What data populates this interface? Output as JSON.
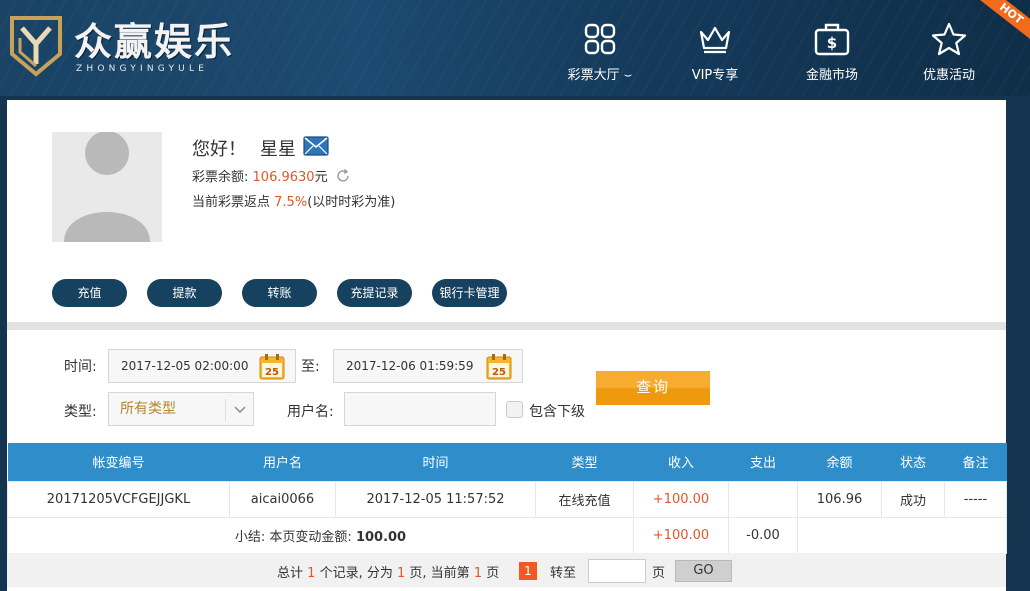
{
  "header": {
    "brand_title": "众赢娱乐",
    "brand_subtitle": "ZHONGYINGYULE",
    "nav": [
      {
        "label": "彩票大厅",
        "icon": "grid-icon"
      },
      {
        "label": "VIP专享",
        "icon": "crown-icon"
      },
      {
        "label": "金融市场",
        "icon": "briefcase-dollar-icon"
      },
      {
        "label": "优惠活动",
        "icon": "star-icon"
      }
    ],
    "hot_badge": "HOT"
  },
  "profile": {
    "greeting": "您好！",
    "username": "星星",
    "balance_label": "彩票余额:",
    "balance_value": "106.9630",
    "balance_unit": "元",
    "rebate_label": "当前彩票返点",
    "rebate_value": "7.5%",
    "rebate_note": "(以时时彩为准)"
  },
  "actions": [
    "充值",
    "提款",
    "转账",
    "充提记录",
    "银行卡管理"
  ],
  "filters": {
    "time_label": "时间:",
    "start_time": "2017-12-05 02:00:00",
    "to_label": "至:",
    "end_time": "2017-12-06 01:59:59",
    "calendar_day": "25",
    "type_label": "类型:",
    "type_value": "所有类型",
    "username_label": "用户名:",
    "username_value": "",
    "include_sub_label": "包含下级",
    "query_button": "查询"
  },
  "table": {
    "headers": [
      "帐变编号",
      "用户名",
      "时间",
      "类型",
      "收入",
      "支出",
      "余额",
      "状态",
      "备注"
    ],
    "rows": [
      [
        "20171205VCFGEJJGKL",
        "aicai0066",
        "2017-12-05 11:57:52",
        "在线充值",
        "+100.00",
        "",
        "106.96",
        "成功",
        "-----"
      ]
    ],
    "summary_label": "小结: 本页变动金额:",
    "summary_amount": "100.00",
    "summary_income": "+100.00",
    "summary_expense": "-0.00"
  },
  "pager": {
    "total_prefix": "总计",
    "total_records": "1",
    "records_suffix": "个记录, 分为",
    "total_pages": "1",
    "pages_suffix": "页, 当前第",
    "current_page": "1",
    "current_suffix": "页",
    "page_button": "1",
    "goto_label": "转至",
    "goto_suffix": "页",
    "go_button": "GO"
  },
  "colors": {
    "header_bg": "#1a4365",
    "pill_button": "#17425f",
    "table_header": "#2f8ec9",
    "accent_orange": "#e0582b",
    "query_button": "#f7ab30"
  }
}
